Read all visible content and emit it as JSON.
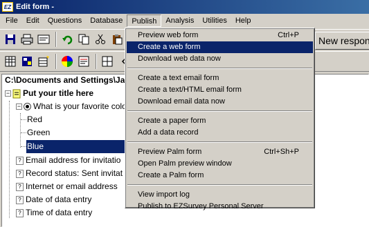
{
  "window": {
    "title": "Edit form -",
    "app_icon_text": "EZ"
  },
  "menubar": {
    "items": [
      {
        "label": "File"
      },
      {
        "label": "Edit"
      },
      {
        "label": "Questions"
      },
      {
        "label": "Database"
      },
      {
        "label": "Publish"
      },
      {
        "label": "Analysis"
      },
      {
        "label": "Utilities"
      },
      {
        "label": "Help"
      }
    ]
  },
  "toolbar": {
    "new_response_label": "New respon"
  },
  "tree": {
    "path": "C:\\Documents and Settings\\Jar",
    "title": "Put your title here",
    "question1": "What is your favorite colo",
    "options": [
      "Red",
      "Green",
      "Blue"
    ],
    "fields": [
      "Email address for invitatio",
      "Record status: Sent invitat",
      "Internet or email address",
      "Date of data entry",
      "Time of data entry"
    ],
    "field_icon": "?"
  },
  "publish_menu": {
    "groups": [
      [
        {
          "label": "Preview web form",
          "shortcut": "Ctrl+P"
        },
        {
          "label": "Create a web form",
          "shortcut": ""
        },
        {
          "label": "Download web data now",
          "shortcut": ""
        }
      ],
      [
        {
          "label": "Create a text email form",
          "shortcut": ""
        },
        {
          "label": "Create a text/HTML email form",
          "shortcut": ""
        },
        {
          "label": "Download email data now",
          "shortcut": ""
        }
      ],
      [
        {
          "label": "Create a paper form",
          "shortcut": ""
        },
        {
          "label": "Add a data record",
          "shortcut": ""
        }
      ],
      [
        {
          "label": "Preview Palm form",
          "shortcut": "Ctrl+Sh+P"
        },
        {
          "label": "Open Palm preview window",
          "shortcut": ""
        },
        {
          "label": "Create a Palm form",
          "shortcut": ""
        }
      ],
      [
        {
          "label": "View import log",
          "shortcut": ""
        },
        {
          "label": "Publish to EZSurvey Personal Server",
          "shortcut": ""
        }
      ]
    ],
    "highlighted": "Create a web form"
  },
  "colors": {
    "selection": "#0a246a",
    "face": "#d4d0c8"
  }
}
